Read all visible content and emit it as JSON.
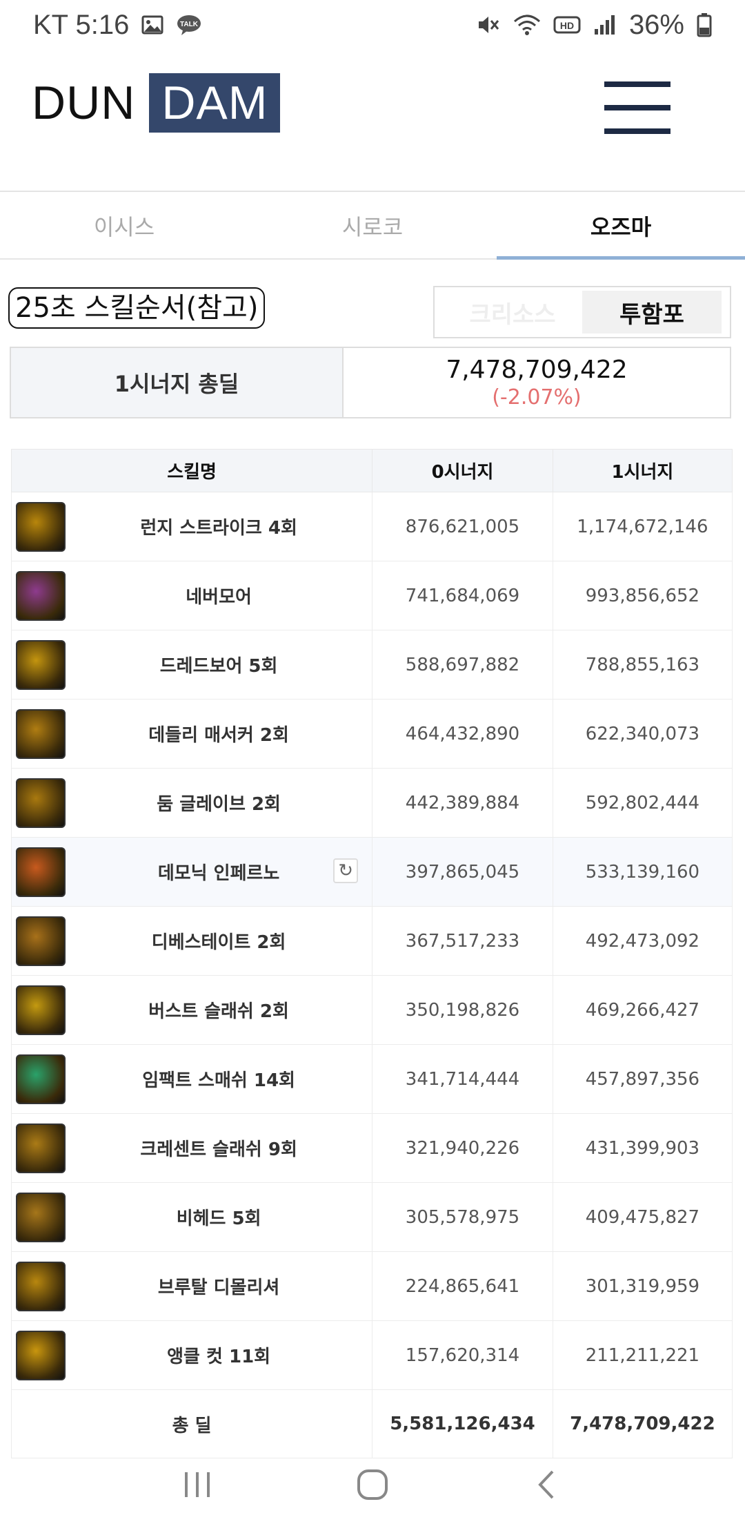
{
  "status_bar": {
    "carrier_time": "KT 5:16",
    "battery": "36%"
  },
  "header": {
    "logo_part1": "DUN",
    "logo_part2": "DAM"
  },
  "tabs": [
    {
      "label": "이시스",
      "active": false
    },
    {
      "label": "시로코",
      "active": false
    },
    {
      "label": "오즈마",
      "active": true
    }
  ],
  "sequence": {
    "title": "25초 스킬순서(참고)",
    "toggle": [
      "크리소스",
      "투함포"
    ],
    "toggle_selected": "투함포"
  },
  "synergy": {
    "label": "1시너지 총딜",
    "value": "7,478,709,422",
    "percent": "(-2.07%)"
  },
  "table": {
    "headers": [
      "스킬명",
      "0시너지",
      "1시너지"
    ],
    "rows": [
      {
        "name": "런지 스트라이크 4회",
        "syn0": "876,621,005",
        "syn1": "1,174,672,146",
        "icon": "lunge-strike-icon",
        "color": "#b8860b"
      },
      {
        "name": "네버모어",
        "syn0": "741,684,069",
        "syn1": "993,856,652",
        "icon": "nevermore-icon",
        "color": "#8e3b8e"
      },
      {
        "name": "드레드보어 5회",
        "syn0": "588,697,882",
        "syn1": "788,855,163",
        "icon": "dreadbore-icon",
        "color": "#c4950f"
      },
      {
        "name": "데들리 매서커 2회",
        "syn0": "464,432,890",
        "syn1": "622,340,073",
        "icon": "deadly-massacre-icon",
        "color": "#b07d12"
      },
      {
        "name": "둠 글레이브 2회",
        "syn0": "442,389,884",
        "syn1": "592,802,444",
        "icon": "doom-glaive-icon",
        "color": "#a9790f"
      },
      {
        "name": "데모닉 인페르노",
        "syn0": "397,865,045",
        "syn1": "533,139,160",
        "icon": "demonic-inferno-icon",
        "color": "#c85a1e"
      },
      {
        "name": "디베스테이트 2회",
        "syn0": "367,517,233",
        "syn1": "492,473,092",
        "icon": "devastate-icon",
        "color": "#a8711a"
      },
      {
        "name": "버스트 슬래쉬 2회",
        "syn0": "350,198,826",
        "syn1": "469,266,427",
        "icon": "burst-slash-icon",
        "color": "#c49a10"
      },
      {
        "name": "임팩트 스매쉬 14회",
        "syn0": "341,714,444",
        "syn1": "457,897,356",
        "icon": "impact-smash-icon",
        "color": "#2aa26a"
      },
      {
        "name": "크레센트 슬래쉬 9회",
        "syn0": "321,940,226",
        "syn1": "431,399,903",
        "icon": "crescent-slash-icon",
        "color": "#ab7b16"
      },
      {
        "name": "비헤드 5회",
        "syn0": "305,578,975",
        "syn1": "409,475,827",
        "icon": "behead-icon",
        "color": "#a6761a"
      },
      {
        "name": "브루탈 디몰리셔",
        "syn0": "224,865,641",
        "syn1": "301,319,959",
        "icon": "brutal-demolisher-icon",
        "color": "#b8870f"
      },
      {
        "name": "앵클 컷 11회",
        "syn0": "157,620,314",
        "syn1": "211,211,221",
        "icon": "ankle-cut-icon",
        "color": "#c9960e"
      }
    ],
    "total": {
      "label": "총 딜",
      "syn0": "5,581,126,434",
      "syn1": "7,478,709,422"
    }
  }
}
